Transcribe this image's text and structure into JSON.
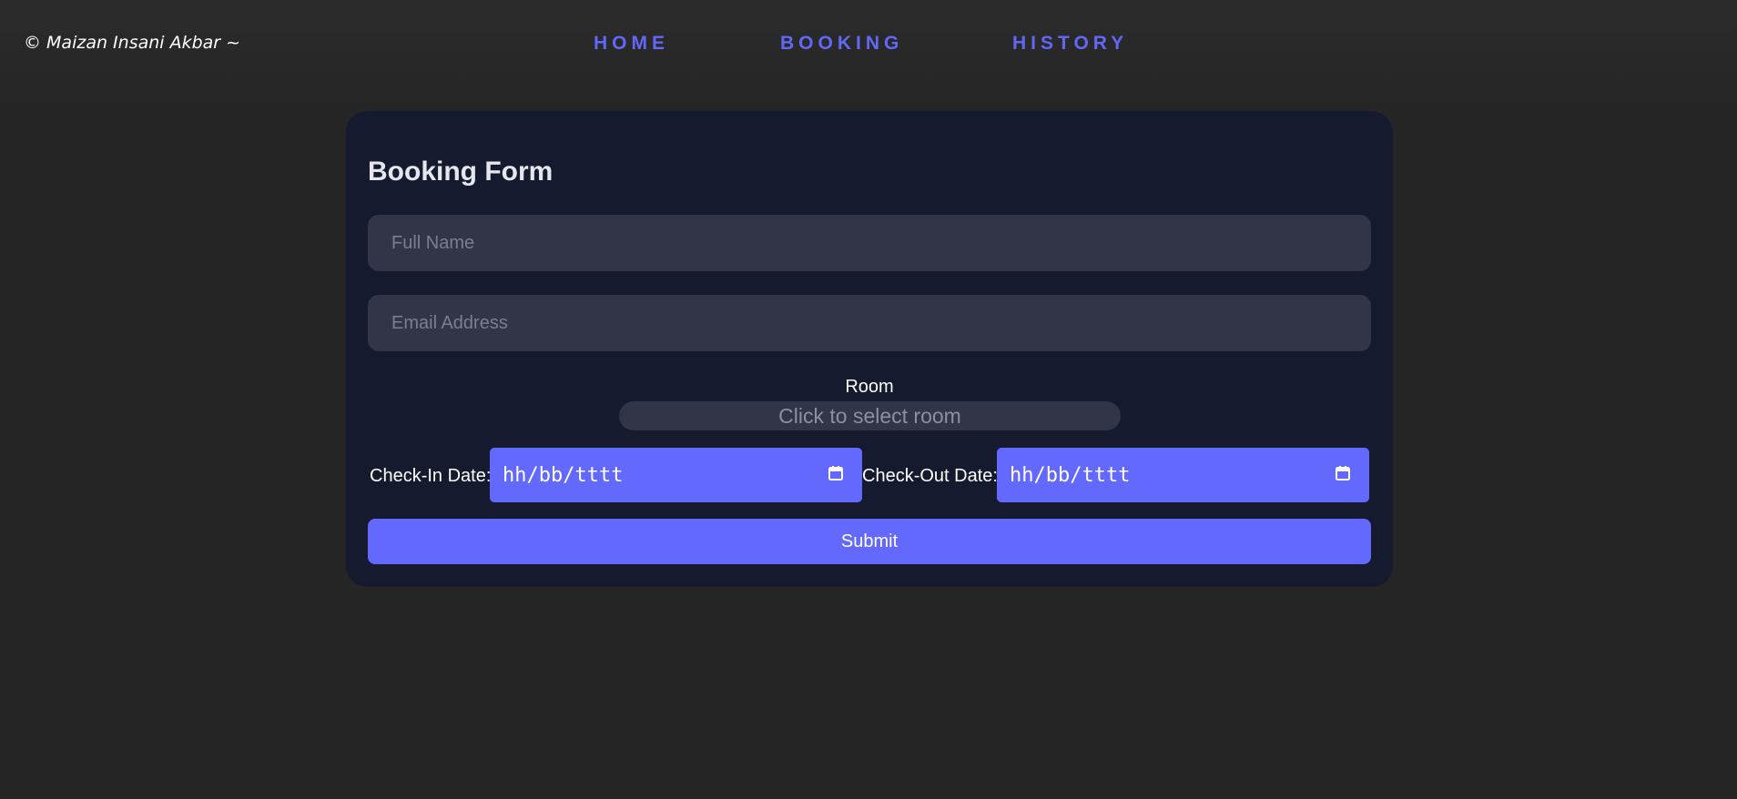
{
  "header": {
    "copyright": "© Maizan Insani Akbar ~",
    "nav": [
      {
        "label": "HOME"
      },
      {
        "label": "BOOKING"
      },
      {
        "label": "HISTORY"
      }
    ]
  },
  "form": {
    "title": "Booking Form",
    "full_name": {
      "value": "",
      "placeholder": "Full Name"
    },
    "email": {
      "value": "",
      "placeholder": "Email Address"
    },
    "room_label": "Room",
    "room_placeholder": "Click to select room",
    "checkin_label": "Check-In Date:",
    "checkin_value": "hh/bb/tttt",
    "checkout_label": "Check-Out Date:",
    "checkout_value": "hh/bb/tttt",
    "submit_label": "Submit"
  },
  "icons": {
    "calendar": "calendar-icon"
  },
  "colors": {
    "accent": "#6369fc",
    "nav": "#6268f5",
    "card_bg": "#161a2e",
    "field_bg": "#323548",
    "page_bg": "#252525"
  }
}
